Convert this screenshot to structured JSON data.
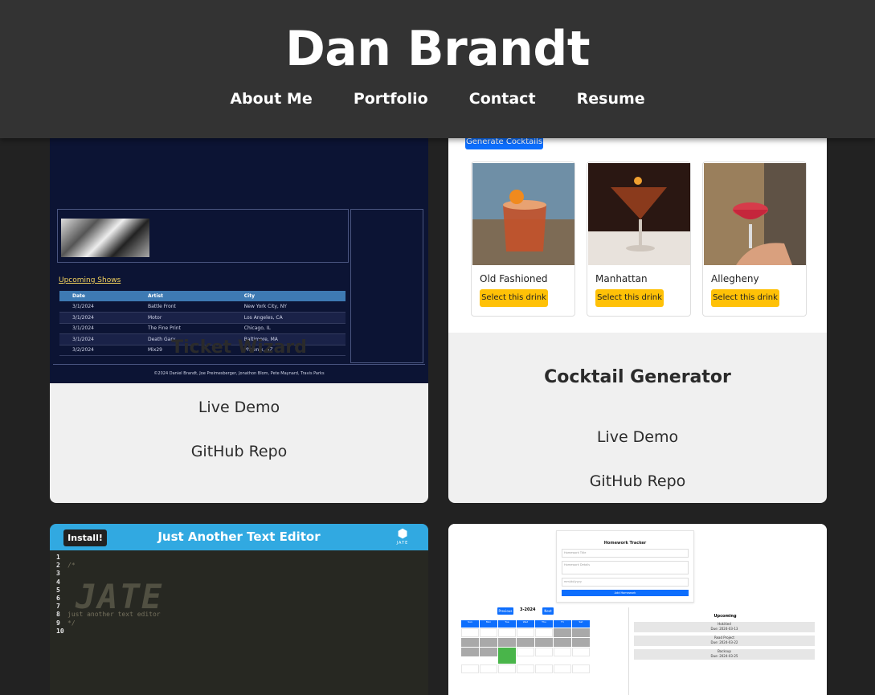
{
  "header": {
    "title": "Dan Brandt",
    "nav": [
      "About Me",
      "Portfolio",
      "Contact",
      "Resume"
    ]
  },
  "projects": [
    {
      "title": "Ticket Wizard",
      "live_label": "Live Demo",
      "repo_label": "GitHub Repo",
      "preview": {
        "heading": "Upcoming Shows",
        "columns": [
          "Date",
          "Artist",
          "City"
        ],
        "rows": [
          [
            "3/1/2024",
            "Battle Front",
            "New York City, NY"
          ],
          [
            "3/1/2024",
            "Motor",
            "Los Angeles, CA"
          ],
          [
            "3/1/2024",
            "The Fine Print",
            "Chicago, IL"
          ],
          [
            "3/1/2024",
            "Death Gary",
            "Baltimore, MA"
          ],
          [
            "3/2/2024",
            "Mix29",
            "Phoenix, AZ"
          ]
        ],
        "footer": "©2024 Daniel Brandt, Joe Preimesberger, Jonathon Blom, Pete Maynard, Travis Parks"
      }
    },
    {
      "title": "Cocktail Generator",
      "live_label": "Live Demo",
      "repo_label": "GitHub Repo",
      "preview": {
        "generate_label": "Generate Cocktails",
        "select_label": "Select this drink",
        "drinks": [
          "Old Fashioned",
          "Manhattan",
          "Allegheny"
        ]
      }
    },
    {
      "title": "",
      "preview": {
        "install_label": "Install!",
        "app_title": "Just Another Text Editor",
        "logo_text": "JATE",
        "lines": [
          "1",
          "2",
          "3",
          "4",
          "5",
          "6",
          "7",
          "8",
          "9",
          "10"
        ],
        "code": [
          "",
          "/*",
          "",
          "",
          "",
          "",
          "",
          "just another text editor",
          "*/",
          ""
        ]
      }
    },
    {
      "title": "",
      "preview": {
        "form_title": "Homework Tracker",
        "field_placeholders": [
          "Homework Title",
          "Homework Details",
          "mm/dd/yyyy"
        ],
        "add_label": "Add Homework",
        "month": "3-2024",
        "prev_label": "Previous",
        "next_label": "Next",
        "days": [
          "Sun",
          "Mon",
          "Tue",
          "Wed",
          "Thu",
          "Fri",
          "Sat"
        ],
        "upcoming_title": "Upcoming",
        "upcoming": [
          {
            "title": "Hokitied",
            "due": "Due: 2024-03-13"
          },
          {
            "title": "Read Project",
            "due": "Due: 2024-03-22"
          },
          {
            "title": "Backsup",
            "due": "Due: 2024-03-25"
          }
        ]
      }
    }
  ]
}
